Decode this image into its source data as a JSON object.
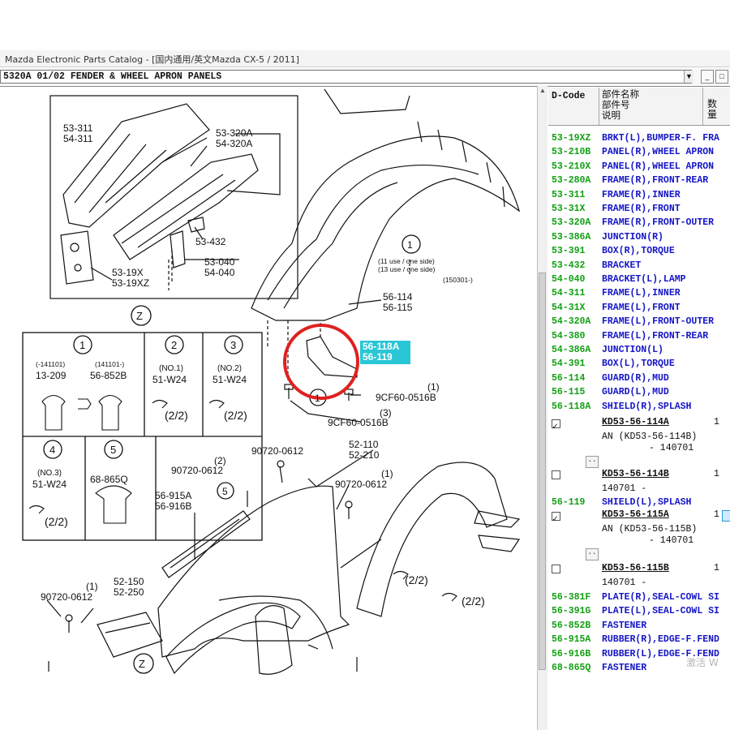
{
  "window": {
    "title": "Mazda Electronic Parts Catalog - [国内通用/英文Mazda CX-5 / 2011]"
  },
  "toolbar": {
    "section_select": "5320A 01/02 FENDER & WHEEL APRON PANELS",
    "dropdown_glyph": "▼",
    "icon_minimize": "_",
    "icon_restore": "□"
  },
  "diagram": {
    "labels": {
      "frame_inner": "53-311\n54-311",
      "frame_outer": "53-320A\n54-320A",
      "bracket": "53-432",
      "box_torque": "53-040\n54-040",
      "bracket_bumper": "53-19X\n53-19XZ",
      "mud_guard": "56-114\n56-115",
      "shield": "56-118A\n56-119",
      "use_note": "(11 use / one side)\n(13 use / one side)",
      "date_note": "(150301-)",
      "bolt_1": "9CF60-0516B",
      "bolt_1_qty": "(1)",
      "bolt_2": "9CF60-0516B",
      "bolt_2_qty": "(3)",
      "fender": "52-110\n52-210",
      "screw_a": "90720-0612",
      "screw_b": "90720-0612",
      "screw_b_qty": "(2)",
      "screw_c": "90720-0612",
      "screw_c_qty": "(1)",
      "rubber": "56-915A\n56-916B",
      "screw_d": "90720-0612",
      "screw_d_qty": "(1)",
      "plate": "52-150\n52-250",
      "frac_1": "(2/2)",
      "frac_2": "(2/2)"
    },
    "callouts": {
      "c1": "1",
      "c5": "5",
      "z": "Z"
    },
    "fastener_table": {
      "cells": [
        {
          "num": "1",
          "label_a_date": "(-141101)",
          "label_a_part": "13-209",
          "label_b_date": "(141101-)",
          "label_b_part": "56-852B"
        },
        {
          "num": "2",
          "note": "(NO.1)",
          "part": "51-W24",
          "frac": "(2/2)"
        },
        {
          "num": "3",
          "note": "(NO.2)",
          "part": "51-W24",
          "frac": "(2/2)"
        },
        {
          "num": "4",
          "note": "(NO.3)",
          "part": "51-W24",
          "frac": "(2/2)"
        },
        {
          "num": "5",
          "part": "68-865Q"
        }
      ]
    }
  },
  "parts_list": {
    "headers": {
      "code": "D-Code",
      "name_lines": [
        "部件名称",
        "部件号",
        "说明"
      ],
      "qty": "数量"
    },
    "rows": [
      {
        "code": "53-19XZ",
        "name": "BRKT(L),BUMPER-F. FRA"
      },
      {
        "code": "53-210B",
        "name": "PANEL(R),WHEEL APRON"
      },
      {
        "code": "53-210X",
        "name": "PANEL(R),WHEEL APRON"
      },
      {
        "code": "53-280A",
        "name": "FRAME(R),FRONT-REAR"
      },
      {
        "code": "53-311",
        "name": "FRAME(R),INNER"
      },
      {
        "code": "53-31X",
        "name": "FRAME(R),FRONT"
      },
      {
        "code": "53-320A",
        "name": "FRAME(R),FRONT-OUTER"
      },
      {
        "code": "53-386A",
        "name": "JUNCTION(R)"
      },
      {
        "code": "53-391",
        "name": "BOX(R),TORQUE"
      },
      {
        "code": "53-432",
        "name": "BRACKET"
      },
      {
        "code": "54-040",
        "name": "BRACKET(L),LAMP"
      },
      {
        "code": "54-311",
        "name": "FRAME(L),INNER"
      },
      {
        "code": "54-31X",
        "name": "FRAME(L),FRONT"
      },
      {
        "code": "54-320A",
        "name": "FRAME(L),FRONT-OUTER"
      },
      {
        "code": "54-380",
        "name": "FRAME(L),FRONT-REAR"
      },
      {
        "code": "54-386A",
        "name": "JUNCTION(L)"
      },
      {
        "code": "54-391",
        "name": "BOX(L),TORQUE"
      },
      {
        "code": "56-114",
        "name": "GUARD(R),MUD"
      },
      {
        "code": "56-115",
        "name": "GUARD(L),MUD"
      },
      {
        "code": "56-118A",
        "name": "SHIELD(R),SPLASH"
      }
    ],
    "sub_a": {
      "part": "KD53-56-114A",
      "qty": "1",
      "note1": "AN (KD53-56-114B)",
      "note2": "- 140701",
      "dots": ".."
    },
    "sub_b": {
      "part": "KD53-56-114B",
      "qty": "1",
      "note1": "140701 -",
      "dots": ".."
    },
    "row_119": {
      "code": "56-119",
      "name": "SHIELD(L),SPLASH"
    },
    "sub_c": {
      "part": "KD53-56-115A",
      "qty": "1",
      "note1": "AN (KD53-56-115B)",
      "note2": "- 140701",
      "dots": ".."
    },
    "sub_d": {
      "part": "KD53-56-115B",
      "qty": "1",
      "note1": "140701 -",
      "dots": ".."
    },
    "rows_tail": [
      {
        "code": "56-381F",
        "name": "PLATE(R),SEAL-COWL SI"
      },
      {
        "code": "56-391G",
        "name": "PLATE(L),SEAL-COWL SI"
      },
      {
        "code": "56-852B",
        "name": "FASTENER"
      },
      {
        "code": "56-915A",
        "name": "RUBBER(R),EDGE-F.FEND"
      },
      {
        "code": "56-916B",
        "name": "RUBBER(L),EDGE-F.FEND"
      },
      {
        "code": "68-865Q",
        "name": "FASTENER"
      }
    ],
    "watermark": "激活 W"
  },
  "colors": {
    "code_green": "#12a012",
    "name_blue": "#1515c8",
    "highlight_cyan": "#29c6d6",
    "circle_red": "#e02020"
  }
}
